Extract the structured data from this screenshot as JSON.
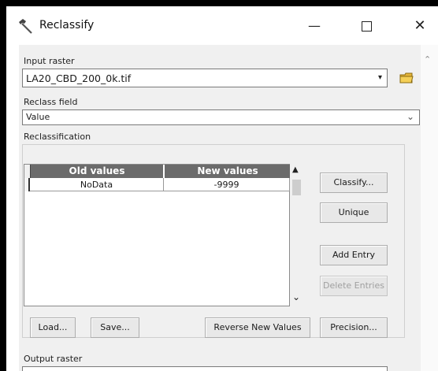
{
  "window": {
    "title": "Reclassify",
    "minimize_glyph": "—",
    "close_glyph": "✕"
  },
  "input_raster": {
    "label": "Input raster",
    "value": "LA20_CBD_200_0k.tif",
    "dropdown_glyph": "▾"
  },
  "reclass_field": {
    "label": "Reclass field",
    "value": "Value",
    "dropdown_glyph": "⌄"
  },
  "reclassification": {
    "label": "Reclassification",
    "columns": [
      "Old values",
      "New values"
    ],
    "rows": [
      {
        "old": "NoData",
        "new": "-9999"
      }
    ],
    "scroll_up_glyph": "▲",
    "scroll_down_glyph": "⌄"
  },
  "buttons": {
    "classify": "Classify...",
    "unique": "Unique",
    "add_entry": "Add Entry",
    "delete_entries": "Delete Entries",
    "load": "Load...",
    "save": "Save...",
    "reverse": "Reverse New Values",
    "precision": "Precision..."
  },
  "output_raster": {
    "label": "Output raster"
  },
  "icons": {
    "title": "hammer-icon",
    "browse": "folder-icon"
  }
}
